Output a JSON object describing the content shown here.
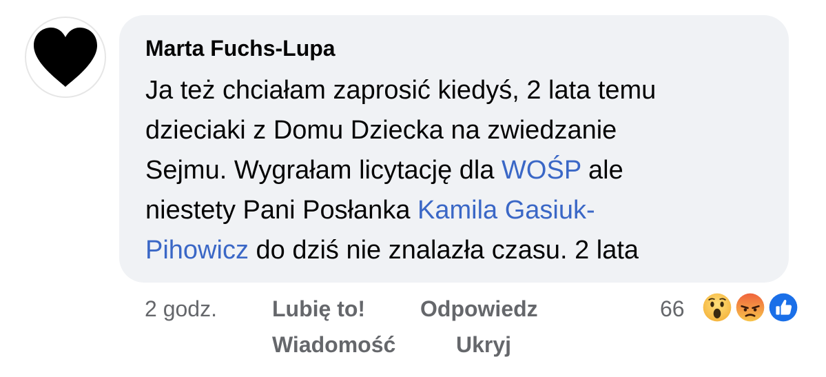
{
  "comment": {
    "author": "Marta Fuchs-Lupa",
    "lines": [
      [
        {
          "text": "Ja też chciałam zaprosić kiedyś, 2 lata temu"
        }
      ],
      [
        {
          "text": "dzieciaki z Domu Dziecka na zwiedzanie"
        }
      ],
      [
        {
          "text": "Sejmu. Wygrałam licytację dla "
        },
        {
          "text": "WOŚP",
          "link": true
        },
        {
          "text": " ale"
        }
      ],
      [
        {
          "text": "niestety Pani Posłanka "
        },
        {
          "text": "Kamila Gasiuk-",
          "link": true
        }
      ],
      [
        {
          "text": "Pihowicz",
          "link": true
        },
        {
          "text": " do dziś nie znalazła czasu. 2 lata"
        }
      ]
    ]
  },
  "meta": {
    "time": "2 godz.",
    "like_label": "Lubię to!",
    "reply_label": "Odpowiedz",
    "message_label": "Wiadomość",
    "hide_label": "Ukryj",
    "reaction_count": "66",
    "reactions": [
      "wow-icon",
      "angry-icon",
      "like-icon"
    ]
  },
  "colors": {
    "bubble": "#f0f2f5",
    "link": "#3a67c6",
    "secondary": "#65676b",
    "text": "#050505"
  }
}
